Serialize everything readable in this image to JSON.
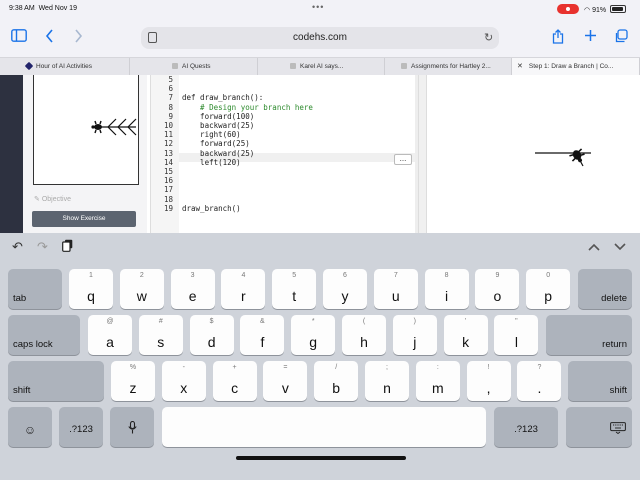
{
  "status_bar": {
    "time": "9:38 AM",
    "date": "Wed Nov 19",
    "battery": "91%",
    "more_icon": "ellipsis-icon",
    "record_icon": "screen-record-icon"
  },
  "browser": {
    "url": "codehs.com",
    "icons": {
      "sidebar": "sidebar-icon",
      "back": "chevron-left-icon",
      "forward": "chevron-right-icon",
      "share": "share-icon",
      "new_tab": "plus-icon",
      "tabs": "tabs-overview-icon",
      "reload": "reload-icon"
    },
    "tabs": [
      {
        "label": "Hour of AI Activities",
        "active": false
      },
      {
        "label": "AI Quests",
        "active": false
      },
      {
        "label": "Karel AI says...",
        "active": false
      },
      {
        "label": "Assignments for Hartley 2...",
        "active": false
      },
      {
        "label": "Step 1: Draw a Branch | Co...",
        "active": true
      }
    ]
  },
  "left_panel": {
    "objective_label": "Objective",
    "show_exercise_label": "Show Exercise"
  },
  "editor": {
    "line_numbers": [
      "5",
      "6",
      "7",
      "8",
      "9",
      "10",
      "11",
      "12",
      "13",
      "14",
      "15",
      "16",
      "17",
      "18",
      "19"
    ],
    "code_lines": [
      "",
      "",
      "def draw_branch():",
      "    # Design your branch here",
      "    forward(100)",
      "    backward(25)",
      "    right(60)",
      "    forward(25)",
      "    backward(25)",
      "    left(120)",
      "",
      "",
      "",
      "",
      "draw_branch()"
    ],
    "more_button": "..."
  },
  "keyboard": {
    "toolbar_icons": [
      "undo-icon",
      "redo-icon",
      "paste-icon",
      "chevron-up-icon",
      "chevron-down-icon"
    ],
    "row1": [
      {
        "alt": "1",
        "main": "q"
      },
      {
        "alt": "2",
        "main": "w"
      },
      {
        "alt": "3",
        "main": "e"
      },
      {
        "alt": "4",
        "main": "r"
      },
      {
        "alt": "5",
        "main": "t"
      },
      {
        "alt": "6",
        "main": "y"
      },
      {
        "alt": "7",
        "main": "u"
      },
      {
        "alt": "8",
        "main": "i"
      },
      {
        "alt": "9",
        "main": "o"
      },
      {
        "alt": "0",
        "main": "p"
      }
    ],
    "row2": [
      {
        "alt": "@",
        "main": "a"
      },
      {
        "alt": "#",
        "main": "s"
      },
      {
        "alt": "$",
        "main": "d"
      },
      {
        "alt": "&",
        "main": "f"
      },
      {
        "alt": "*",
        "main": "g"
      },
      {
        "alt": "(",
        "main": "h"
      },
      {
        "alt": ")",
        "main": "j"
      },
      {
        "alt": "'",
        "main": "k"
      },
      {
        "alt": "\"",
        "main": "l"
      }
    ],
    "row3": [
      {
        "alt": "%",
        "main": "z"
      },
      {
        "alt": "-",
        "main": "x"
      },
      {
        "alt": "+",
        "main": "c"
      },
      {
        "alt": "=",
        "main": "v"
      },
      {
        "alt": "/",
        "main": "b"
      },
      {
        "alt": ";",
        "main": "n"
      },
      {
        "alt": ":",
        "main": "m"
      },
      {
        "alt": "!",
        "main": ","
      },
      {
        "alt": "?",
        "main": "."
      }
    ],
    "labels": {
      "tab": "tab",
      "delete": "delete",
      "caps_lock": "caps lock",
      "return": "return",
      "shift_left": "shift",
      "shift_right": "shift",
      "num_left": ".?123",
      "num_right": ".?123"
    },
    "icons": {
      "emoji": "emoji-icon",
      "mic": "microphone-icon",
      "dismiss": "keyboard-dismiss-icon"
    }
  }
}
